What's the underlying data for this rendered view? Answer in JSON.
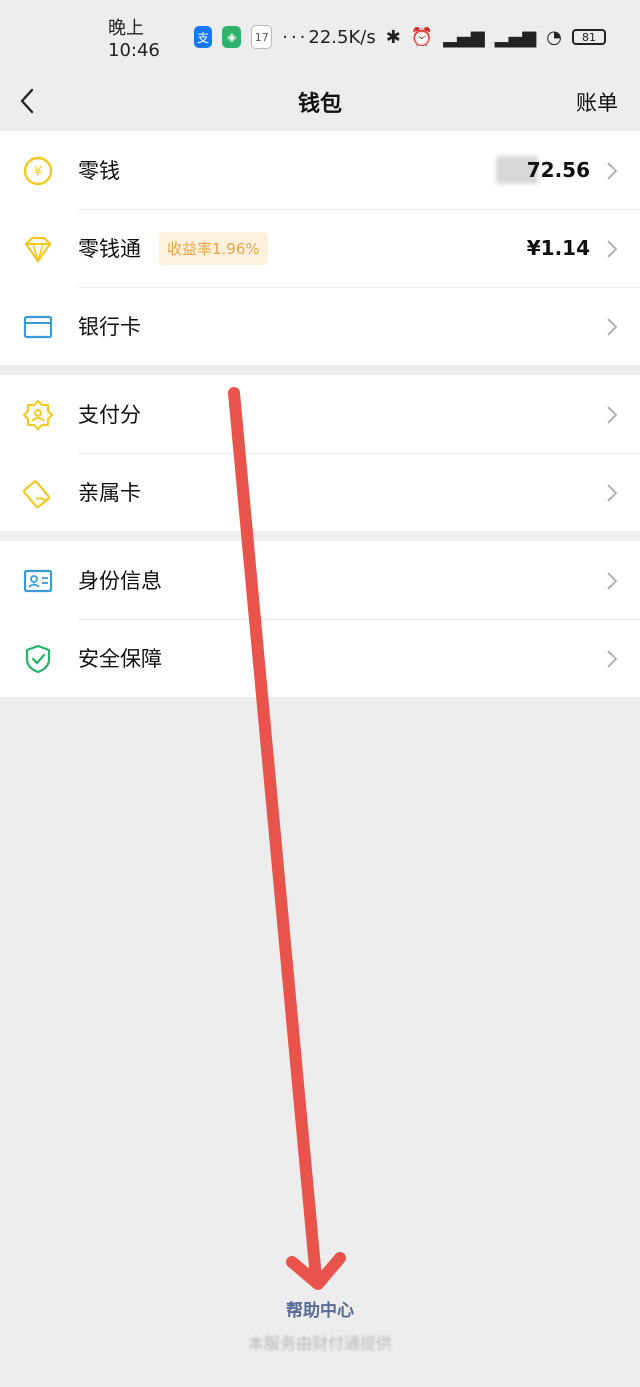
{
  "status_bar": {
    "time": "晚上10:46",
    "calendar_day": "17",
    "more": "···",
    "net_speed": "22.5K/s",
    "battery": "81"
  },
  "header": {
    "title": "钱包",
    "right_link": "账单"
  },
  "groups": [
    {
      "items": [
        {
          "label": "零钱",
          "value": "72.56",
          "icon": "yuan-coin-icon"
        },
        {
          "label": "零钱通",
          "badge": "收益率1.96%",
          "value": "¥1.14",
          "icon": "diamond-icon"
        },
        {
          "label": "银行卡",
          "icon": "bank-card-icon"
        }
      ]
    },
    {
      "items": [
        {
          "label": "支付分",
          "icon": "score-badge-icon"
        },
        {
          "label": "亲属卡",
          "icon": "family-card-icon"
        }
      ]
    },
    {
      "items": [
        {
          "label": "身份信息",
          "icon": "id-card-icon"
        },
        {
          "label": "安全保障",
          "icon": "shield-check-icon"
        }
      ]
    }
  ],
  "footer": {
    "help_center": "帮助中心",
    "provider_note": "本服务由财付通提供"
  },
  "colors": {
    "page_bg": "#ededed",
    "icon_yellow": "#f4c81c",
    "icon_blue": "#3a9ad9",
    "icon_green": "#22b36a",
    "badge_bg": "#fdf1de",
    "badge_text": "#e8a44a",
    "link_blue": "#576b95",
    "annotation_red": "#e8534c"
  }
}
